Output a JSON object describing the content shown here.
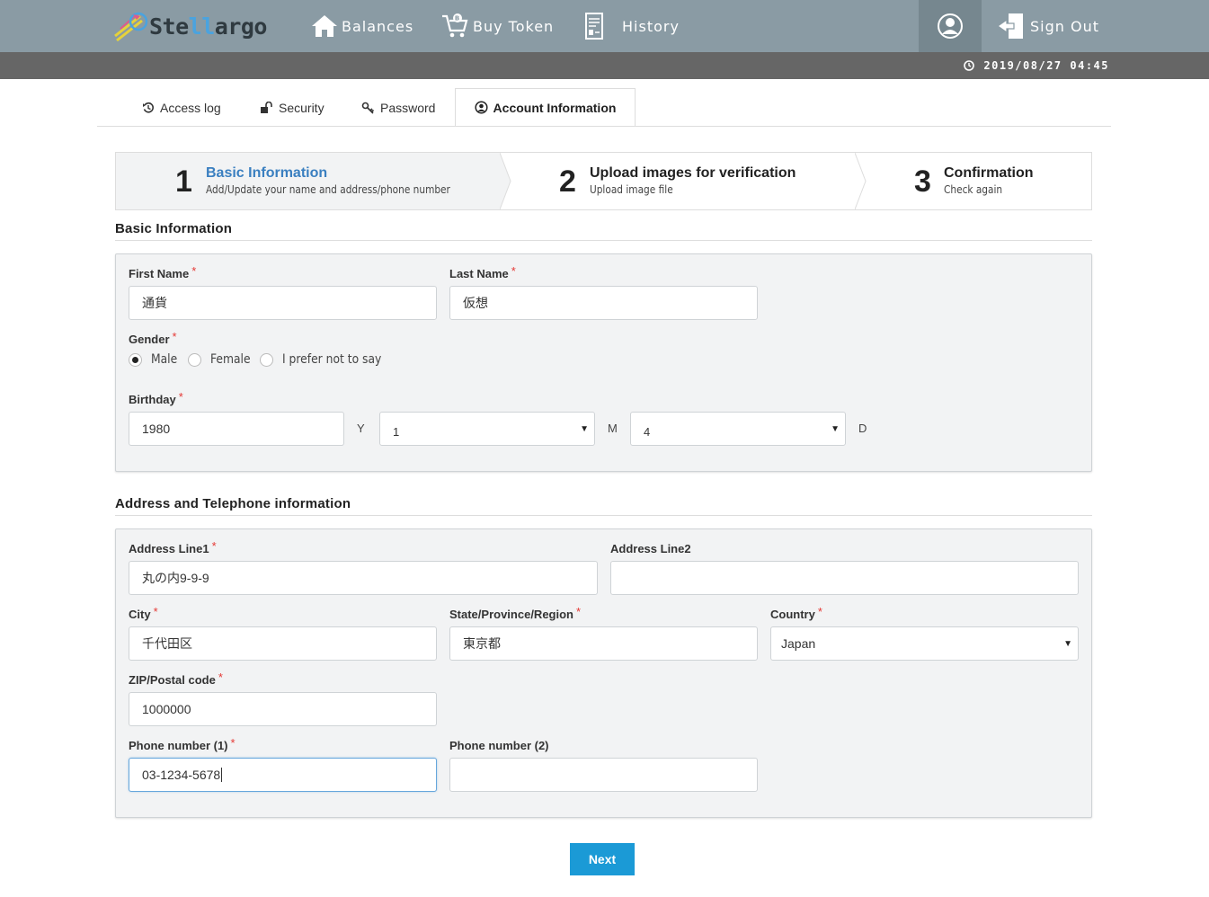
{
  "brand": {
    "name_prefix": "Ste",
    "name_mid": "ll",
    "name_suffix": "argo"
  },
  "nav": {
    "balances": "Balances",
    "buy_token": "Buy Token",
    "history": "History",
    "sign_out": "Sign Out"
  },
  "datetime": "2019/08/27 04:45",
  "tabs": {
    "access_log": "Access log",
    "security": "Security",
    "password": "Password",
    "account_information": "Account Information"
  },
  "steps": [
    {
      "num": "1",
      "title": "Basic Information",
      "sub": "Add/Update your name and address/phone number"
    },
    {
      "num": "2",
      "title": "Upload images for verification",
      "sub": "Upload image file"
    },
    {
      "num": "3",
      "title": "Confirmation",
      "sub": "Check again"
    }
  ],
  "basic": {
    "heading": "Basic Information",
    "first_name_label": "First Name",
    "first_name": "通貨",
    "last_name_label": "Last Name",
    "last_name": "仮想",
    "gender_label": "Gender",
    "gender_options": [
      "Male",
      "Female",
      "I prefer not to say"
    ],
    "gender_selected": "Male",
    "birthday_label": "Birthday",
    "birth_year": "1980",
    "year_unit": "Y",
    "birth_month": "1",
    "month_unit": "M",
    "birth_day": "4",
    "day_unit": "D",
    "required_mark": "*"
  },
  "address": {
    "heading": "Address and Telephone information",
    "line1_label": "Address Line1",
    "line1": "丸の内9-9-9",
    "line2_label": "Address Line2",
    "line2": "",
    "city_label": "City",
    "city": "千代田区",
    "state_label": "State/Province/Region",
    "state": "東京都",
    "country_label": "Country",
    "country": "Japan",
    "zip_label": "ZIP/Postal code",
    "zip": "1000000",
    "phone1_label": "Phone number (1)",
    "phone1": "03-1234-5678",
    "phone2_label": "Phone number (2)",
    "phone2": ""
  },
  "next_button": "Next"
}
